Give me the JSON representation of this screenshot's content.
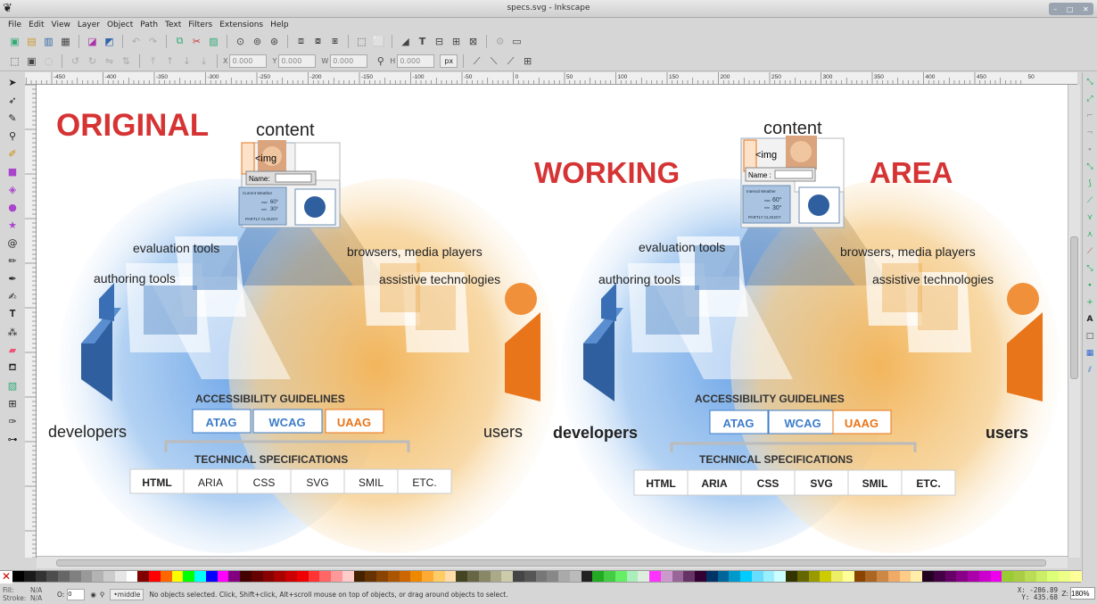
{
  "window": {
    "title": "specs.svg - Inkscape"
  },
  "menu": [
    "File",
    "Edit",
    "View",
    "Layer",
    "Object",
    "Path",
    "Text",
    "Filters",
    "Extensions",
    "Help"
  ],
  "controls": {
    "x_label": "X",
    "x_value": "0.000",
    "y_label": "Y",
    "y_value": "0.000",
    "w_label": "W",
    "w_value": "0.000",
    "h_label": "H",
    "h_value": "0.000",
    "unit": "px"
  },
  "ruler": {
    "h_labels": [
      "-450",
      "-400",
      "-350",
      "-300",
      "-250",
      "-200",
      "-150",
      "-100",
      "-50",
      "0",
      "50",
      "100",
      "150",
      "200",
      "250",
      "300",
      "350",
      "400",
      "450",
      "50"
    ]
  },
  "drawing": {
    "original_label": "ORIGINAL",
    "working_label": "WORKING",
    "area_label": "AREA",
    "content": "content",
    "img_tag": "<img",
    "name_field": "Name:",
    "name_field_right": "Name :",
    "weather_title": "Current Weather",
    "weather_title_right": "Interval Weather",
    "weather_max": "max",
    "weather_min": "min",
    "temp_high": "60°",
    "temp_low": "30°",
    "weather_cond": "PARTLY CLOUDY",
    "evaluation_tools": "evaluation tools",
    "authoring_tools": "authoring tools",
    "browsers": "browsers, media players",
    "assistive": "assistive technologies",
    "guidelines_title": "ACCESSIBILITY GUIDELINES",
    "atag": "ATAG",
    "wcag": "WCAG",
    "uaag": "UAAG",
    "developers": "developers",
    "users": "users",
    "specs_title": "TECHNICAL SPECIFICATIONS",
    "specs": [
      "HTML",
      "ARIA",
      "CSS",
      "SVG",
      "SMIL",
      "ETC."
    ]
  },
  "colors": {
    "red": "#d63434",
    "blue": "#3d7cc9",
    "orange": "#e8751a",
    "dark_blue": "#2f5f9e"
  },
  "status": {
    "fill_label": "Fill:",
    "stroke_label": "Stroke:",
    "fill_value": "N/A",
    "stroke_value": "N/A",
    "opacity_label": "O:",
    "opacity_value": "0",
    "layer": "•middle",
    "message": "No objects selected. Click, Shift+click, Alt+scroll mouse on top of objects, or drag around objects to select.",
    "coord_x": "X: -286.89",
    "coord_y": "Y: 435.68",
    "zoom_label": "Z:",
    "zoom_value": "180%"
  }
}
